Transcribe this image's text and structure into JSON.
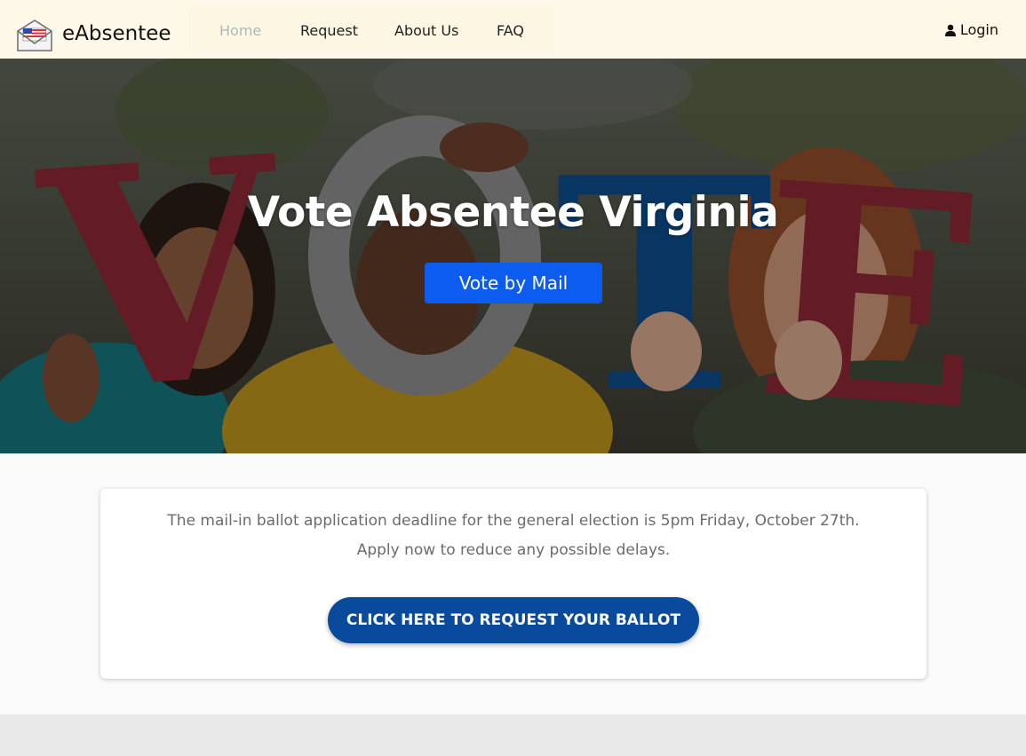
{
  "header": {
    "brand": "eAbsentee",
    "nav": [
      {
        "label": "Home",
        "active": true
      },
      {
        "label": "Request",
        "active": false
      },
      {
        "label": "About Us",
        "active": false
      },
      {
        "label": "FAQ",
        "active": false
      }
    ],
    "login_label": "Login",
    "login_icon": "user-icon",
    "logo_icon": "envelope-flag-icon"
  },
  "hero": {
    "title": "Vote Absentee Virginia",
    "button_label": "Vote by Mail",
    "image_letters": [
      "V",
      "O",
      "T",
      "E"
    ],
    "button_color": "#0d5cf0"
  },
  "notice": {
    "line1": "The mail-in ballot application deadline for the general election is 5pm Friday, October 27th.",
    "line2": "Apply now to reduce any possible delays.",
    "cta_label": "CLICK HERE TO REQUEST YOUR BALLOT",
    "cta_color": "#0a4a9c"
  },
  "colors": {
    "header_bg": "#fef8e8",
    "nav_active": "#a9bcb6",
    "footer_bg": "#e9e9e9"
  }
}
